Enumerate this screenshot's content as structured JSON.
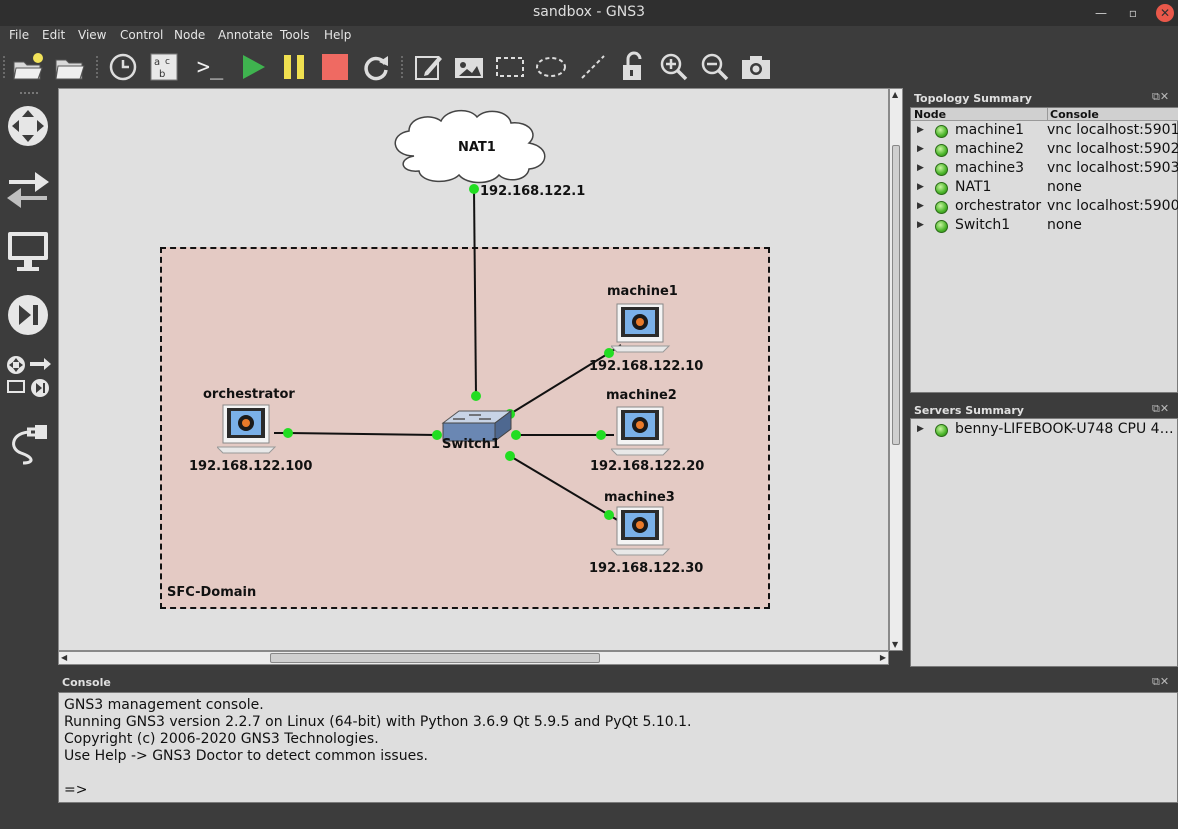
{
  "window": {
    "title": "sandbox - GNS3"
  },
  "menu": [
    {
      "label": "File"
    },
    {
      "label": "Edit"
    },
    {
      "label": "View"
    },
    {
      "label": "Control"
    },
    {
      "label": "Node"
    },
    {
      "label": "Annotate"
    },
    {
      "label": "Tools"
    },
    {
      "label": "Help"
    }
  ],
  "toolbar": {
    "icons": [
      "open-folder-new-icon",
      "open-folder-icon",
      "clock-icon",
      "abc-icon",
      "terminal-icon",
      "play-icon",
      "pause-icon",
      "stop-icon",
      "reload-icon",
      "edit-note-icon",
      "image-icon",
      "rectangle-icon",
      "ellipse-icon",
      "line-icon",
      "unlock-icon",
      "zoom-in-icon",
      "zoom-out-icon",
      "camera-icon"
    ],
    "terminal_label": ">_"
  },
  "topology": {
    "domain_label": "SFC-Domain",
    "nodes": {
      "nat": {
        "name": "NAT1",
        "ip": "192.168.122.1"
      },
      "switch": {
        "name": "Switch1"
      },
      "orchestrator": {
        "name": "orchestrator",
        "ip": "192.168.122.100"
      },
      "machine1": {
        "name": "machine1",
        "ip": "192.168.122.10"
      },
      "machine2": {
        "name": "machine2",
        "ip": "192.168.122.20"
      },
      "machine3": {
        "name": "machine3",
        "ip": "192.168.122.30"
      }
    }
  },
  "topology_summary": {
    "title": "Topology Summary",
    "columns": [
      "Node",
      "Console"
    ],
    "rows": [
      {
        "node": "machine1",
        "console": "vnc localhost:5901"
      },
      {
        "node": "machine2",
        "console": "vnc localhost:5902"
      },
      {
        "node": "machine3",
        "console": "vnc localhost:5903"
      },
      {
        "node": "NAT1",
        "console": "none"
      },
      {
        "node": "orchestrator",
        "console": "vnc localhost:5900"
      },
      {
        "node": "Switch1",
        "console": "none"
      }
    ]
  },
  "servers_summary": {
    "title": "Servers Summary",
    "rows": [
      {
        "name": "benny-LIFEBOOK-U748 CPU 4…"
      }
    ]
  },
  "console": {
    "title": "Console",
    "lines": [
      "GNS3 management console.",
      "Running GNS3 version 2.2.7 on Linux (64-bit) with Python 3.6.9 Qt 5.9.5 and PyQt 5.10.1.",
      "Copyright (c) 2006-2020 GNS3 Technologies.",
      "Use Help -> GNS3 Doctor to detect common issues.",
      "",
      "=>"
    ]
  },
  "colors": {
    "link_dot": "#22dd22",
    "domain_fill": "#e4cac4",
    "led": "#4bb52a"
  }
}
